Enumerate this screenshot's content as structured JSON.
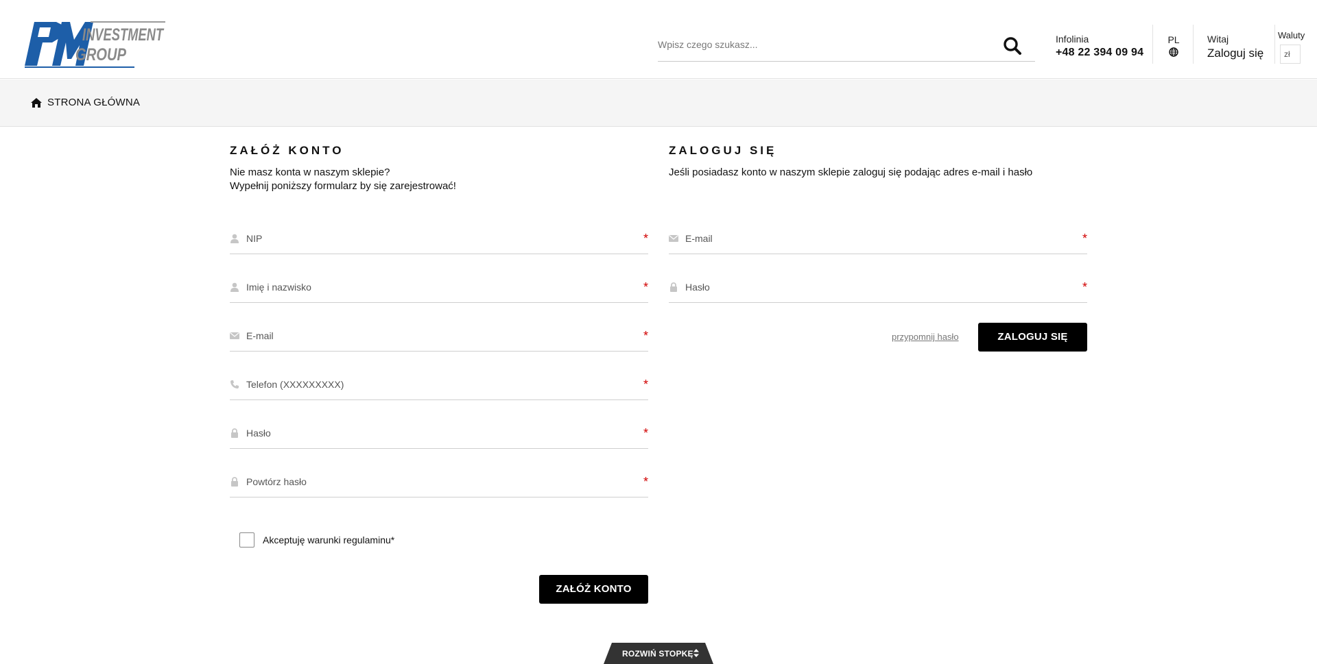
{
  "header": {
    "logo_top": "PM",
    "logo_line1": "INVESTMENT",
    "logo_line2": "GROUP",
    "search_placeholder": "Wpisz czego szukasz...",
    "infolinia_label": "Infolinia",
    "infolinia_phone": "+48 22 394 09 94",
    "language_code": "PL",
    "welcome_label": "Witaj",
    "login_link": "Zaloguj się",
    "currency_label": "Waluty",
    "currency_value": "zł"
  },
  "breadcrumb": {
    "home_label": "STRONA GŁÓWNA"
  },
  "register": {
    "title": "ZAŁÓŻ KONTO",
    "desc_line1": "Nie masz konta w naszym sklepie?",
    "desc_line2": "Wypełnij poniższy formularz by się zarejestrować!",
    "fields": [
      {
        "label": "NIP",
        "icon": "user-icon",
        "required": "*"
      },
      {
        "label": "Imię i nazwisko",
        "icon": "user-icon",
        "required": "*"
      },
      {
        "label": "E-mail",
        "icon": "envelope-icon",
        "required": "*"
      },
      {
        "label": "Telefon (XXXXXXXXX)",
        "icon": "phone-icon",
        "required": "*"
      },
      {
        "label": "Hasło",
        "icon": "lock-icon",
        "required": "*"
      },
      {
        "label": "Powtórz hasło",
        "icon": "lock-icon",
        "required": "*"
      }
    ],
    "terms_label": "Akceptuję warunki regulaminu*",
    "submit_label": "ZAŁÓŻ KONTO"
  },
  "login": {
    "title": "ZALOGUJ SIĘ",
    "desc": "Jeśli posiadasz konto w naszym sklepie zaloguj się podając adres e-mail i hasło",
    "fields": [
      {
        "label": "E-mail",
        "icon": "envelope-icon",
        "required": "*"
      },
      {
        "label": "Hasło",
        "icon": "lock-icon",
        "required": "*"
      }
    ],
    "forgot_label": "przypomnij hasło",
    "submit_label": "ZALOGUJ SIĘ"
  },
  "footer": {
    "toggle_label": "ROZWIŃ STOPKĘ"
  },
  "colors": {
    "brand_blue": "#1d5ea8",
    "brand_gray": "#8a8a8a",
    "required_red": "#d10000",
    "button_black": "#000000",
    "breadcrumb_bg": "#f5f5f5",
    "footer_tab": "#333333"
  }
}
